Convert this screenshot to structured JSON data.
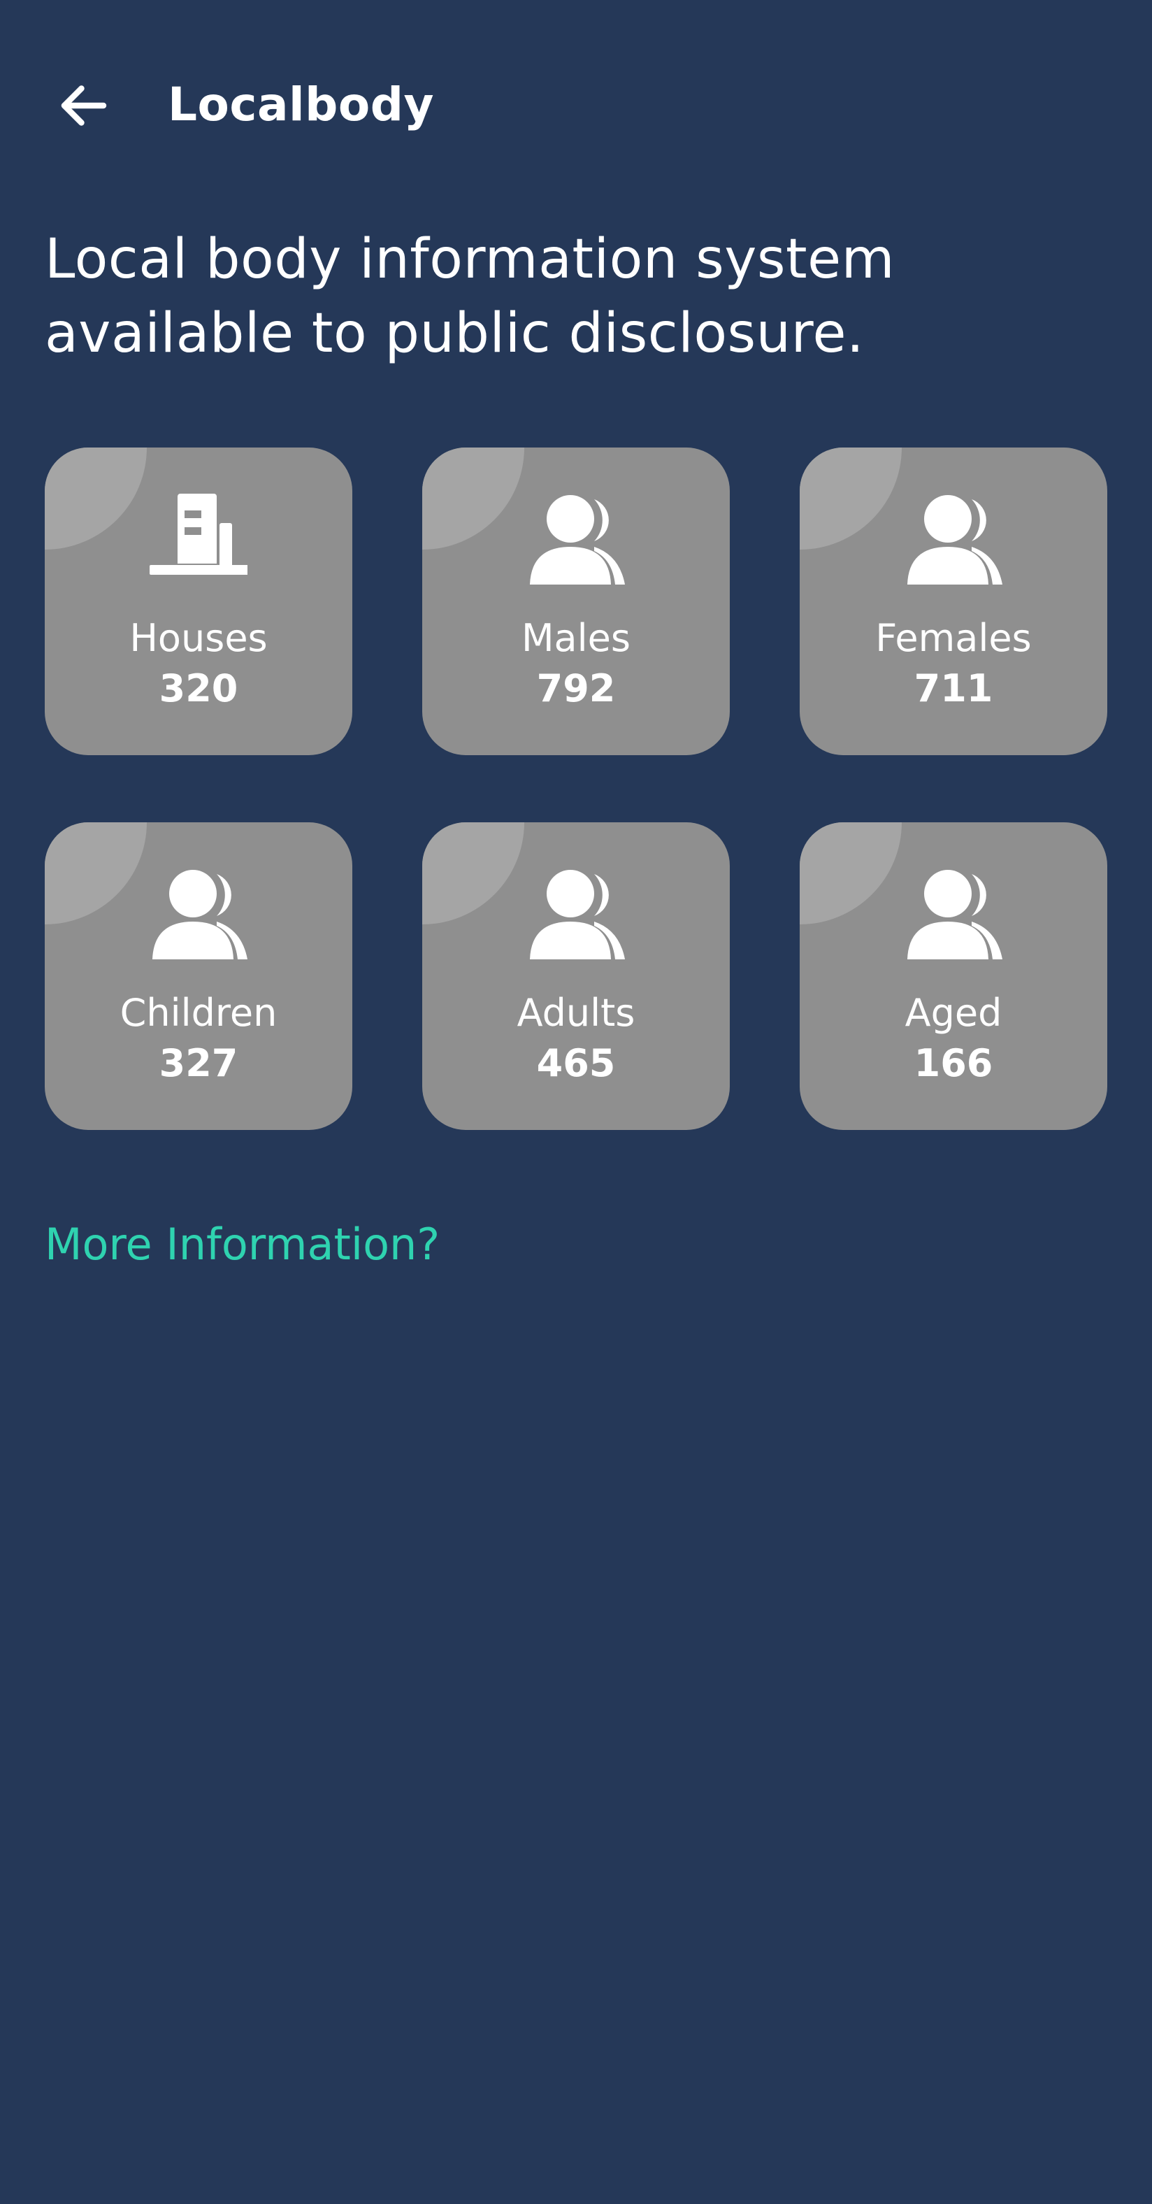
{
  "header": {
    "back_icon": "arrow-left-icon",
    "title": "Localbody"
  },
  "description": "Local body information system available to public disclosure.",
  "stats": [
    {
      "label": "Houses",
      "value": "320",
      "icon": "building-icon"
    },
    {
      "label": "Males",
      "value": "792",
      "icon": "users-icon"
    },
    {
      "label": "Females",
      "value": "711",
      "icon": "users-icon"
    },
    {
      "label": "Children",
      "value": "327",
      "icon": "users-icon"
    },
    {
      "label": "Adults",
      "value": "465",
      "icon": "users-icon"
    },
    {
      "label": "Aged",
      "value": "166",
      "icon": "users-icon"
    }
  ],
  "more_link": "More Information?",
  "colors": {
    "background": "#253858",
    "card": "#8f8f8f",
    "card_corner": "#a5a5a5",
    "text": "#ffffff",
    "accent": "#2fd3b0"
  }
}
